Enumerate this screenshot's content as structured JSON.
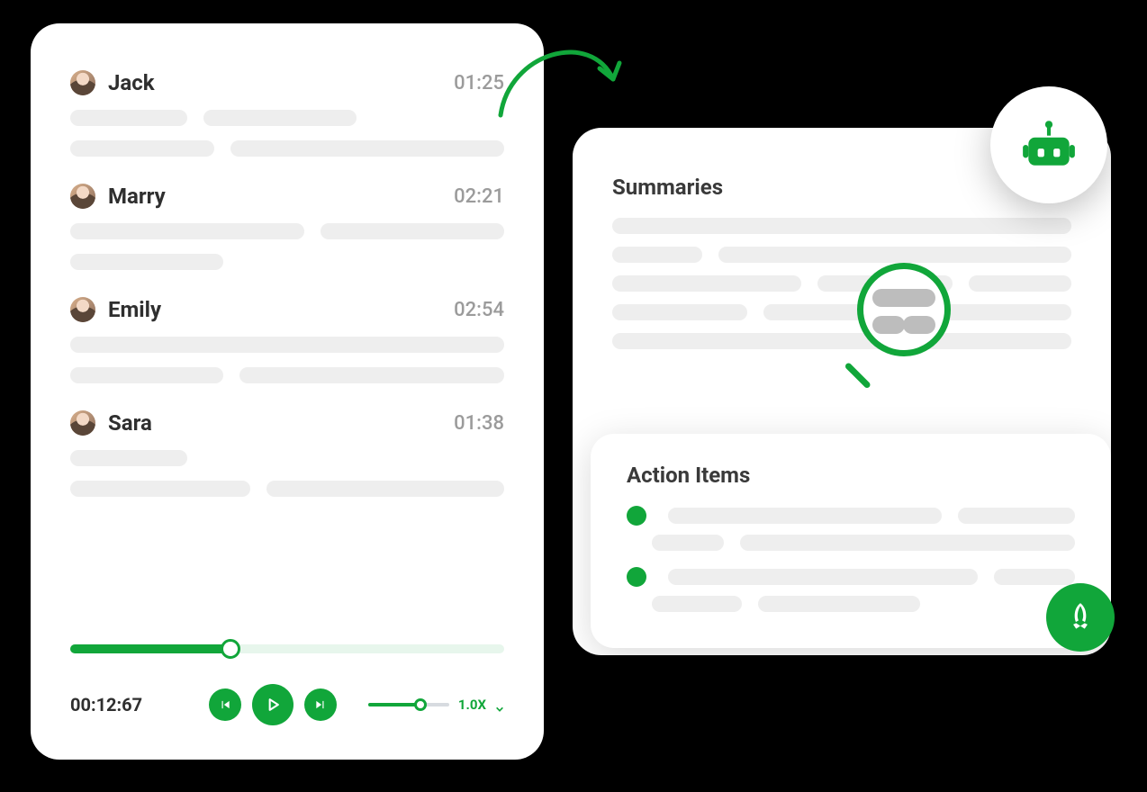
{
  "transcript": {
    "speakers": [
      {
        "name": "Jack",
        "time": "01:25"
      },
      {
        "name": "Marry",
        "time": "02:21"
      },
      {
        "name": "Emily",
        "time": "02:54"
      },
      {
        "name": "Sara",
        "time": "01:38"
      }
    ],
    "player": {
      "elapsed": "00:12:67",
      "speed_label": "1.0X"
    }
  },
  "summary": {
    "summaries_title": "Summaries",
    "action_items_title": "Action Items"
  }
}
